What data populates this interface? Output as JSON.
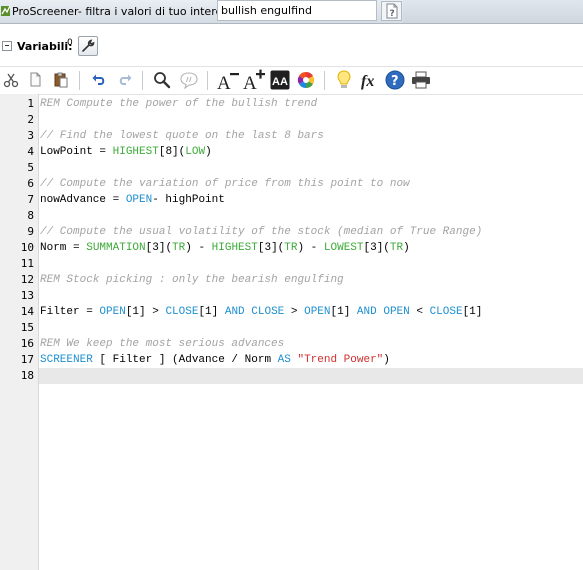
{
  "window": {
    "title": "ProScreener- filtra i valori di tuo interesse",
    "name_value": "bullish engulfind"
  },
  "variables": {
    "label": "Variabili:",
    "count": "0"
  },
  "toolbar": {
    "items": [
      "cut-icon",
      "copy-icon",
      "paste-icon",
      "undo-icon",
      "redo-icon",
      "search-icon",
      "comment-icon",
      "decrease-font-icon",
      "increase-font-icon",
      "font-color-icon",
      "color-wheel-icon",
      "lightbulb-icon",
      "function-icon",
      "help-icon",
      "print-icon"
    ],
    "decrease_font_glyph": "A",
    "increase_font_glyph": "A",
    "font_color_glyph": "AA",
    "function_glyph": "fx",
    "help_glyph": "?"
  },
  "colors": {
    "comment": "#a3a3a3",
    "keyword": "#1f8fcf",
    "function": "#3cab39",
    "string": "#d03030",
    "active_line": "#e8e8e8"
  },
  "editor": {
    "line_numbers": [
      "1",
      "2",
      "3",
      "4",
      "5",
      "6",
      "7",
      "8",
      "9",
      "10",
      "11",
      "12",
      "13",
      "14",
      "15",
      "16",
      "17",
      "18"
    ],
    "active_line": 18,
    "lines": [
      [
        {
          "t": "REM Compute the power of the bullish trend",
          "c": "cm"
        }
      ],
      [],
      [
        {
          "t": "// Find the lowest quote on the last 8 bars",
          "c": "cm"
        }
      ],
      [
        {
          "t": "LowPoint = ",
          "c": "pl"
        },
        {
          "t": "HIGHEST",
          "c": "fn"
        },
        {
          "t": "[8](",
          "c": "pl"
        },
        {
          "t": "LOW",
          "c": "fn"
        },
        {
          "t": ")",
          "c": "pl"
        }
      ],
      [],
      [
        {
          "t": "// Compute the variation of price from this point to now",
          "c": "cm"
        }
      ],
      [
        {
          "t": "nowAdvance = ",
          "c": "pl"
        },
        {
          "t": "OPEN",
          "c": "kw"
        },
        {
          "t": "- highPoint",
          "c": "pl"
        }
      ],
      [],
      [
        {
          "t": "// Compute the usual volatility of the stock (median of True Range)",
          "c": "cm"
        }
      ],
      [
        {
          "t": "Norm = ",
          "c": "pl"
        },
        {
          "t": "SUMMATION",
          "c": "fn"
        },
        {
          "t": "[3](",
          "c": "pl"
        },
        {
          "t": "TR",
          "c": "fn"
        },
        {
          "t": ") - ",
          "c": "pl"
        },
        {
          "t": "HIGHEST",
          "c": "fn"
        },
        {
          "t": "[3](",
          "c": "pl"
        },
        {
          "t": "TR",
          "c": "fn"
        },
        {
          "t": ") - ",
          "c": "pl"
        },
        {
          "t": "LOWEST",
          "c": "fn"
        },
        {
          "t": "[3](",
          "c": "pl"
        },
        {
          "t": "TR",
          "c": "fn"
        },
        {
          "t": ")",
          "c": "pl"
        }
      ],
      [],
      [
        {
          "t": "REM Stock picking : only the bearish engulfing",
          "c": "cm"
        }
      ],
      [],
      [
        {
          "t": "Filter = ",
          "c": "pl"
        },
        {
          "t": "OPEN",
          "c": "kw"
        },
        {
          "t": "[1] > ",
          "c": "pl"
        },
        {
          "t": "CLOSE",
          "c": "kw"
        },
        {
          "t": "[1] ",
          "c": "pl"
        },
        {
          "t": "AND",
          "c": "kw"
        },
        {
          "t": " ",
          "c": "pl"
        },
        {
          "t": "CLOSE",
          "c": "kw"
        },
        {
          "t": " > ",
          "c": "pl"
        },
        {
          "t": "OPEN",
          "c": "kw"
        },
        {
          "t": "[1] ",
          "c": "pl"
        },
        {
          "t": "AND",
          "c": "kw"
        },
        {
          "t": " ",
          "c": "pl"
        },
        {
          "t": "OPEN",
          "c": "kw"
        },
        {
          "t": " < ",
          "c": "pl"
        },
        {
          "t": "CLOSE",
          "c": "kw"
        },
        {
          "t": "[1]",
          "c": "pl"
        }
      ],
      [],
      [
        {
          "t": "REM We keep the most serious advances",
          "c": "cm"
        }
      ],
      [
        {
          "t": "SCREENER",
          "c": "kw"
        },
        {
          "t": " [ Filter ] (Advance / Norm ",
          "c": "pl"
        },
        {
          "t": "AS",
          "c": "kw"
        },
        {
          "t": " ",
          "c": "pl"
        },
        {
          "t": "\"Trend Power\"",
          "c": "str"
        },
        {
          "t": ")",
          "c": "pl"
        }
      ],
      []
    ]
  }
}
